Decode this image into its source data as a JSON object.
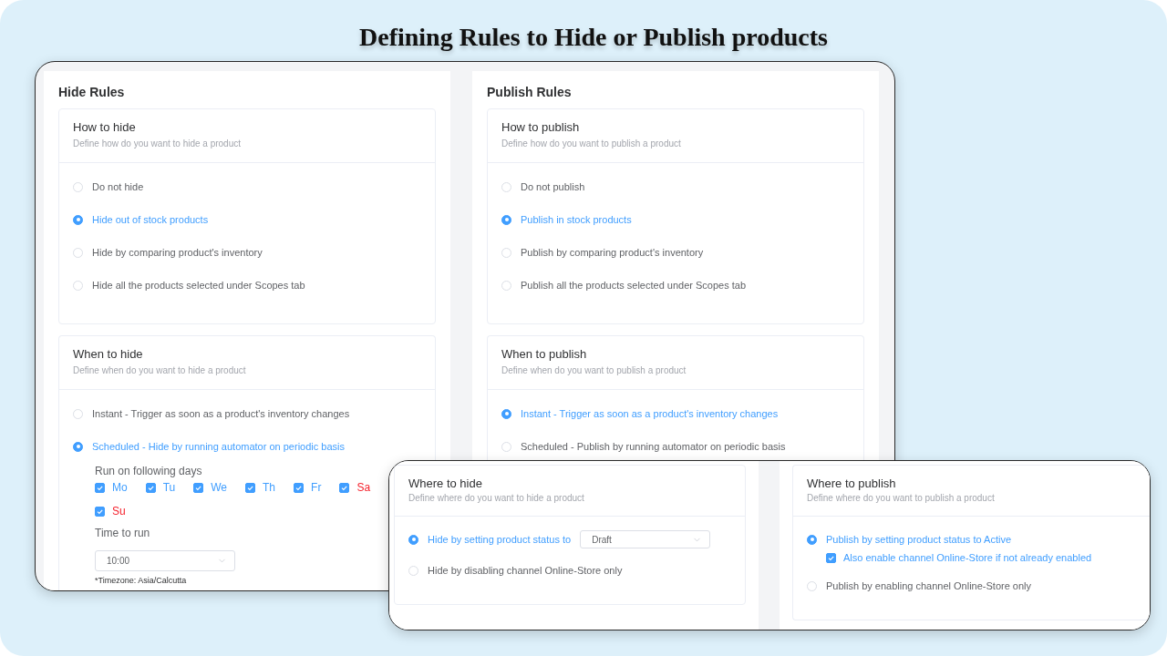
{
  "title": "Defining Rules to Hide or Publish products",
  "panels": [
    {
      "heading": "Hide Rules",
      "sections": [
        {
          "title": "How to hide",
          "subtitle": "Define how do you want to hide a product",
          "options": [
            {
              "label": "Do not hide",
              "selected": false
            },
            {
              "label": "Hide out of stock products",
              "selected": true
            },
            {
              "label": "Hide by comparing product's inventory",
              "selected": false
            },
            {
              "label": "Hide all the products selected under Scopes tab",
              "selected": false
            }
          ]
        },
        {
          "title": "When to hide",
          "subtitle": "Define when do you want to hide a product",
          "options": [
            {
              "label": "Instant - Trigger as soon as a product's inventory changes",
              "selected": false
            },
            {
              "label": "Scheduled - Hide by running automator on periodic basis",
              "selected": true,
              "schedule": {
                "days_label": "Run on following days",
                "days": [
                  {
                    "label": "Mo",
                    "checked": true,
                    "color": "#409eff"
                  },
                  {
                    "label": "Tu",
                    "checked": true,
                    "color": "#409eff"
                  },
                  {
                    "label": "We",
                    "checked": true,
                    "color": "#409eff"
                  },
                  {
                    "label": "Th",
                    "checked": true,
                    "color": "#409eff"
                  },
                  {
                    "label": "Fr",
                    "checked": true,
                    "color": "#409eff"
                  },
                  {
                    "label": "Sa",
                    "checked": true,
                    "color": "#f5222d"
                  },
                  {
                    "label": "Su",
                    "checked": true,
                    "color": "#f5222d"
                  }
                ],
                "time_label": "Time to run",
                "time": {
                  "value": "10:00"
                },
                "note": "*Timezone: Asia/Calcutta"
              }
            }
          ]
        }
      ]
    },
    {
      "heading": "Publish Rules",
      "sections": [
        {
          "title": "How to publish",
          "subtitle": "Define how do you want to publish a product",
          "options": [
            {
              "label": "Do not publish",
              "selected": false
            },
            {
              "label": "Publish in stock products",
              "selected": true
            },
            {
              "label": "Publish by comparing product's inventory",
              "selected": false
            },
            {
              "label": "Publish all the products selected under Scopes tab",
              "selected": false
            }
          ]
        },
        {
          "title": "When to publish",
          "subtitle": "Define when do you want to publish a product",
          "options": [
            {
              "label": "Instant - Trigger as soon as a product's inventory changes",
              "selected": true
            },
            {
              "label": "Scheduled - Publish by running automator on periodic basis",
              "selected": false
            }
          ]
        }
      ]
    }
  ],
  "overlay": {
    "sections": [
      {
        "title": "Where to hide",
        "subtitle": "Define where do you want to hide a product",
        "options": [
          {
            "label": "Hide by setting product status to",
            "selected": true,
            "select": {
              "value": "Draft"
            }
          },
          {
            "label": "Hide by disabling channel Online-Store only",
            "selected": false
          }
        ]
      },
      {
        "title": "Where to publish",
        "subtitle": "Define where do you want to publish a product",
        "options": [
          {
            "label": "Publish by setting product status to Active",
            "selected": true,
            "checkbox": {
              "label": "Also enable channel Online-Store if not already enabled",
              "checked": true
            }
          },
          {
            "label": "Publish by enabling channel Online-Store only",
            "selected": false
          }
        ]
      }
    ]
  }
}
